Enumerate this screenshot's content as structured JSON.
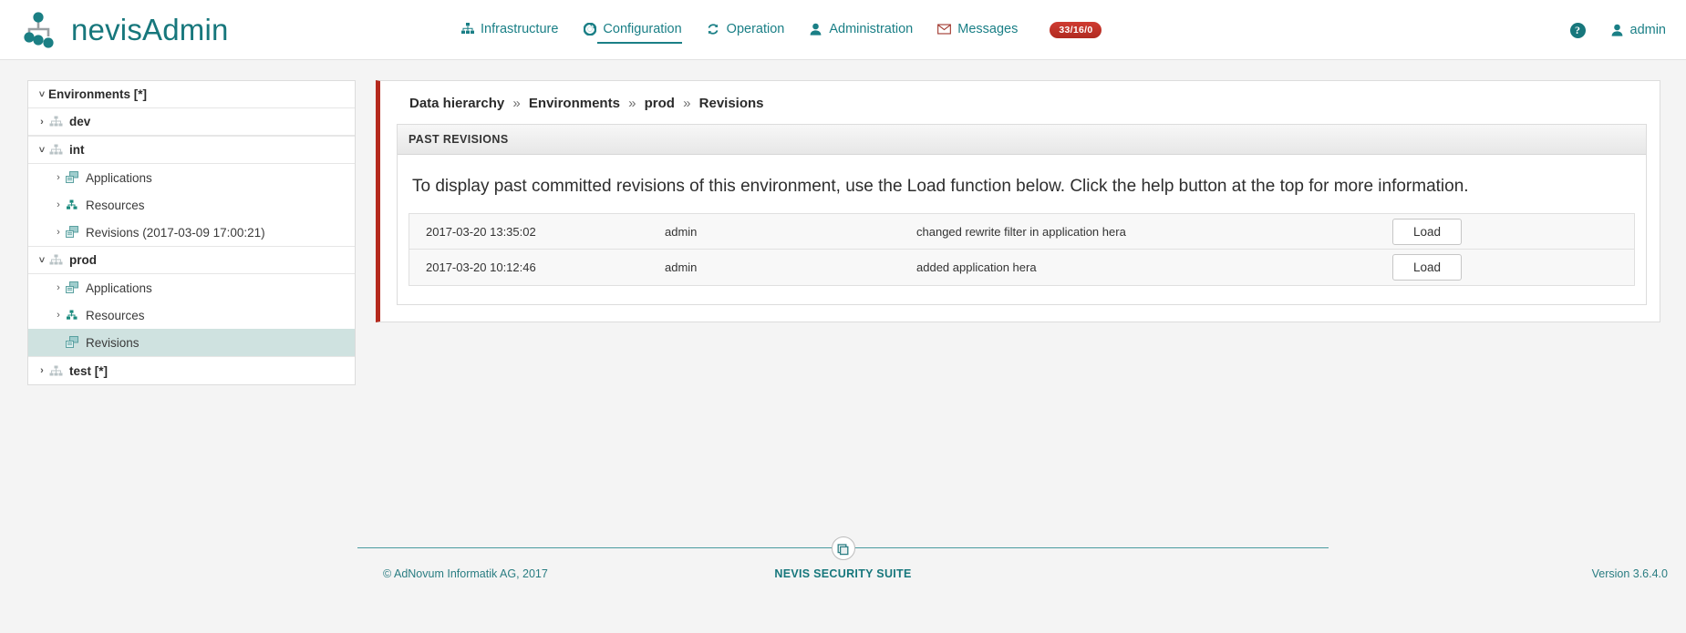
{
  "header": {
    "brand": "nevisAdmin",
    "logo_icon": "node-graph-logo-icon",
    "nav": [
      {
        "label": "Infrastructure",
        "icon": "sitemap-icon",
        "active": false
      },
      {
        "label": "Configuration",
        "icon": "gear-icon",
        "active": true
      },
      {
        "label": "Operation",
        "icon": "refresh-icon",
        "active": false
      },
      {
        "label": "Administration",
        "icon": "user-icon",
        "active": false
      },
      {
        "label": "Messages",
        "icon": "envelope-icon",
        "active": false
      }
    ],
    "messages_badge": "33/16/0",
    "help_icon": "question-mark-icon",
    "help_label": "?",
    "user_icon": "user-icon",
    "user_label": "admin",
    "accent_teal": "#17777c",
    "badge_red": "#b02a20"
  },
  "sidebar": {
    "root": {
      "label": "Environments [*]",
      "expanded": true,
      "chevron": "˅"
    },
    "nodes": [
      {
        "label": "dev",
        "type": "environment",
        "expanded": false,
        "chevron": "›",
        "icon": "sitemap-icon",
        "level": 0,
        "selected": false
      },
      {
        "label": "int",
        "type": "environment",
        "expanded": true,
        "chevron": "˅",
        "icon": "sitemap-icon",
        "level": 0,
        "selected": false
      },
      {
        "label": "Applications",
        "type": "folder",
        "expanded": false,
        "chevron": "›",
        "icon": "applications-icon",
        "level": 1,
        "selected": false
      },
      {
        "label": "Resources",
        "type": "folder",
        "expanded": false,
        "chevron": "›",
        "icon": "resources-icon",
        "level": 1,
        "selected": false
      },
      {
        "label": "Revisions (2017-03-09 17:00:21)",
        "type": "folder",
        "expanded": false,
        "chevron": "›",
        "icon": "applications-icon",
        "level": 1,
        "selected": false
      },
      {
        "label": "prod",
        "type": "environment",
        "expanded": true,
        "chevron": "˅",
        "icon": "sitemap-icon",
        "level": 0,
        "selected": false
      },
      {
        "label": "Applications",
        "type": "folder",
        "expanded": false,
        "chevron": "›",
        "icon": "applications-icon",
        "level": 1,
        "selected": false
      },
      {
        "label": "Resources",
        "type": "folder",
        "expanded": false,
        "chevron": "›",
        "icon": "resources-icon",
        "level": 1,
        "selected": false
      },
      {
        "label": "Revisions",
        "type": "folder",
        "expanded": false,
        "chevron": "",
        "icon": "applications-icon",
        "level": 1,
        "selected": true
      },
      {
        "label": "test [*]",
        "type": "environment",
        "expanded": false,
        "chevron": "›",
        "icon": "sitemap-icon",
        "level": 0,
        "selected": false
      }
    ],
    "selected_bg": "#cfe2e0"
  },
  "main": {
    "breadcrumb": {
      "separator": "»",
      "items": [
        "Data hierarchy",
        "Environments",
        "prod",
        "Revisions"
      ]
    },
    "panel_title": "PAST REVISIONS",
    "intro_text": "To display past committed revisions of this environment, use the Load function below. Click the help button at the top for more information.",
    "accent_bar_color": "#b5291d",
    "revisions": [
      {
        "timestamp": "2017-03-20 13:35:02",
        "user": "admin",
        "message": "changed rewrite filter in application hera",
        "action_label": "Load"
      },
      {
        "timestamp": "2017-03-20 10:12:46",
        "user": "admin",
        "message": "added application hera",
        "action_label": "Load"
      }
    ]
  },
  "footer": {
    "copyright": "© AdNovum Informatik AG, 2017",
    "suite": "NEVIS SECURITY SUITE",
    "version": "Version 3.6.4.0",
    "badge_icon": "nevis-seal-icon"
  }
}
